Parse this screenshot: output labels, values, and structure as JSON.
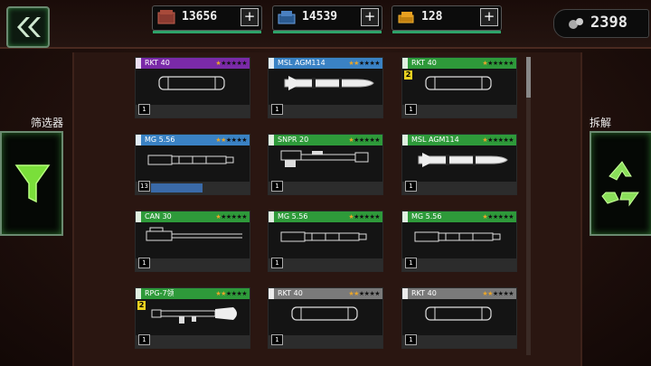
{
  "resources": [
    {
      "name": "crate-resource",
      "value": "13656",
      "plus": "+"
    },
    {
      "name": "metal-resource",
      "value": "14539",
      "plus": "+"
    },
    {
      "name": "gold-resource",
      "value": "128",
      "plus": "+"
    }
  ],
  "premium": {
    "value": "2398"
  },
  "sidebar": {
    "filter_label": "筛选器",
    "dismantle_label": "拆解"
  },
  "colors": {
    "purple": "#7a2aa8",
    "blue": "#3a82c4",
    "green": "#2e9a3a",
    "gray": "#7a7a7a",
    "accent": "#2ea36a"
  },
  "cards": [
    {
      "name": "RKT 40",
      "stars": 1,
      "qty": "1",
      "rarity": "purple",
      "weapon": "rocket-icon"
    },
    {
      "name": "MSL AGM114",
      "stars": 2,
      "qty": "1",
      "rarity": "blue",
      "weapon": "missile-icon"
    },
    {
      "name": "RKT 40",
      "stars": 1,
      "qty": "1",
      "rarity": "green",
      "weapon": "rocket-icon",
      "level": "2"
    },
    {
      "name": "MG 5.56",
      "stars": 2,
      "qty": "13",
      "rarity": "blue",
      "weapon": "machinegun-icon",
      "progress": 0.45
    },
    {
      "name": "SNPR 20",
      "stars": 1,
      "qty": "1",
      "rarity": "green",
      "weapon": "sniper-icon"
    },
    {
      "name": "MSL AGM114",
      "stars": 1,
      "qty": "1",
      "rarity": "green",
      "weapon": "missile-icon"
    },
    {
      "name": "CAN 30",
      "stars": 1,
      "qty": "1",
      "rarity": "green",
      "weapon": "cannon-icon"
    },
    {
      "name": "MG 5.56",
      "stars": 1,
      "qty": "1",
      "rarity": "green",
      "weapon": "machinegun-icon"
    },
    {
      "name": "MG 5.56",
      "stars": 1,
      "qty": "1",
      "rarity": "green",
      "weapon": "machinegun-icon"
    },
    {
      "name": "RPG-7领",
      "stars": 2,
      "qty": "1",
      "rarity": "green",
      "weapon": "rpg-icon",
      "level": "2"
    },
    {
      "name": "RKT 40",
      "stars": 2,
      "qty": "1",
      "rarity": "gray",
      "weapon": "rocket-icon"
    },
    {
      "name": "RKT 40",
      "stars": 2,
      "qty": "1",
      "rarity": "gray",
      "weapon": "rocket-icon"
    }
  ]
}
